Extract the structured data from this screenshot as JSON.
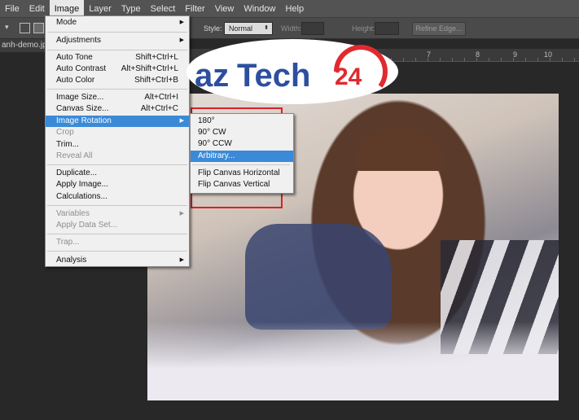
{
  "menubar": {
    "items": [
      "File",
      "Edit",
      "Image",
      "Layer",
      "Type",
      "Select",
      "Filter",
      "View",
      "Window",
      "Help"
    ],
    "active": "Image"
  },
  "options": {
    "style_label": "Style:",
    "style_value": "Normal",
    "width_label": "Width:",
    "height_label": "Height:",
    "refine_edge_label": "Refine Edge..."
  },
  "document": {
    "tab_title": "anh-demo.jpg",
    "ruler_numbers": [
      "7",
      "8",
      "9",
      "10"
    ]
  },
  "image_menu": {
    "items": [
      {
        "label": "Mode",
        "shortcut": "",
        "submenu": true,
        "disabled": false
      },
      {
        "label": "Adjustments",
        "shortcut": "",
        "submenu": true,
        "disabled": false
      },
      {
        "label": "Auto Tone",
        "shortcut": "Shift+Ctrl+L",
        "submenu": false,
        "disabled": false
      },
      {
        "label": "Auto Contrast",
        "shortcut": "Alt+Shift+Ctrl+L",
        "submenu": false,
        "disabled": false
      },
      {
        "label": "Auto Color",
        "shortcut": "Shift+Ctrl+B",
        "submenu": false,
        "disabled": false
      },
      {
        "label": "Image Size...",
        "shortcut": "Alt+Ctrl+I",
        "submenu": false,
        "disabled": false
      },
      {
        "label": "Canvas Size...",
        "shortcut": "Alt+Ctrl+C",
        "submenu": false,
        "disabled": false
      },
      {
        "label": "Image Rotation",
        "shortcut": "",
        "submenu": true,
        "disabled": false,
        "highlighted": true
      },
      {
        "label": "Crop",
        "shortcut": "",
        "submenu": false,
        "disabled": true
      },
      {
        "label": "Trim...",
        "shortcut": "",
        "submenu": false,
        "disabled": false
      },
      {
        "label": "Reveal All",
        "shortcut": "",
        "submenu": false,
        "disabled": true
      },
      {
        "label": "Duplicate...",
        "shortcut": "",
        "submenu": false,
        "disabled": false
      },
      {
        "label": "Apply Image...",
        "shortcut": "",
        "submenu": false,
        "disabled": false
      },
      {
        "label": "Calculations...",
        "shortcut": "",
        "submenu": false,
        "disabled": false
      },
      {
        "label": "Variables",
        "shortcut": "",
        "submenu": true,
        "disabled": true
      },
      {
        "label": "Apply Data Set...",
        "shortcut": "",
        "submenu": false,
        "disabled": true
      },
      {
        "label": "Trap...",
        "shortcut": "",
        "submenu": false,
        "disabled": true
      },
      {
        "label": "Analysis",
        "shortcut": "",
        "submenu": true,
        "disabled": false
      }
    ]
  },
  "rotation_menu": {
    "items": [
      {
        "label": "180°"
      },
      {
        "label": "90° CW"
      },
      {
        "label": "90° CCW"
      },
      {
        "label": "Arbitrary...",
        "highlighted": true
      },
      {
        "label": "Flip Canvas Horizontal"
      },
      {
        "label": "Flip Canvas Vertical"
      }
    ]
  },
  "logo": {
    "text_az": "az",
    "text_tech": "Tech",
    "text_num": "24",
    "color_az": "#2d4fa0",
    "color_red": "#e02a2f"
  },
  "colors": {
    "highlight": "#3b8ad8",
    "annotation_box": "#d8202a"
  }
}
